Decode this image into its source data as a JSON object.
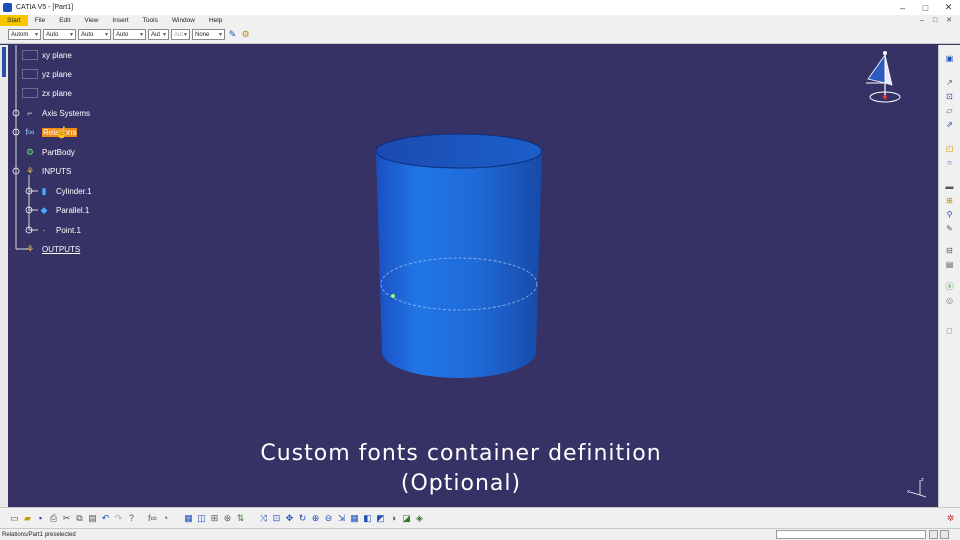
{
  "window": {
    "title": "CATIA V5 - [Part1]",
    "controls": [
      "–",
      "□",
      "✕"
    ]
  },
  "menu": {
    "items": [
      "Start",
      "File",
      "Edit",
      "View",
      "Insert",
      "Tools",
      "Window",
      "Help"
    ],
    "right_controls": [
      "–",
      "□",
      "✕"
    ]
  },
  "toolbar_top": {
    "combos": [
      {
        "value": "Autom",
        "enabled": true
      },
      {
        "value": "Auto",
        "enabled": true
      },
      {
        "value": "Auto",
        "enabled": true
      },
      {
        "value": "Auto",
        "enabled": true
      },
      {
        "value": "Aut",
        "enabled": true
      },
      {
        "value": "Aut",
        "enabled": false
      },
      {
        "value": "None",
        "enabled": true
      }
    ],
    "icons": [
      "painter-icon",
      "format-painter-icon"
    ]
  },
  "tree": {
    "items": [
      {
        "label": "xy plane",
        "icon": "plane-icon",
        "style": "normal"
      },
      {
        "label": "yz plane",
        "icon": "plane-icon",
        "style": "normal"
      },
      {
        "label": "zx plane",
        "icon": "plane-icon",
        "style": "normal"
      },
      {
        "label": "Axis Systems",
        "icon": "axis-system-icon",
        "style": "normal"
      },
      {
        "label": "Relations",
        "icon": "relations-icon",
        "style": "highlight"
      },
      {
        "label": "PartBody",
        "icon": "partbody-icon",
        "style": "normal"
      },
      {
        "label": "INPUTS",
        "icon": "geometrical-set-icon",
        "style": "normal"
      },
      {
        "label": "Cylinder.1",
        "icon": "cylinder-icon",
        "style": "normal"
      },
      {
        "label": "Parallel.1",
        "icon": "parallel-icon",
        "style": "normal"
      },
      {
        "label": "Point.1",
        "icon": "point-icon",
        "style": "normal"
      },
      {
        "label": "OUTPUTS",
        "icon": "geometrical-set-icon",
        "style": "underline"
      }
    ]
  },
  "caption": {
    "line1": "Custom fonts container definition",
    "line2": "(Optional)"
  },
  "status": {
    "text": "Relations/Part1 preselected"
  },
  "colors": {
    "viewport_bg": "#363265",
    "cylinder": "#1e6fd8",
    "highlight": "#f08a16",
    "selection_accent": "#f7c600"
  }
}
